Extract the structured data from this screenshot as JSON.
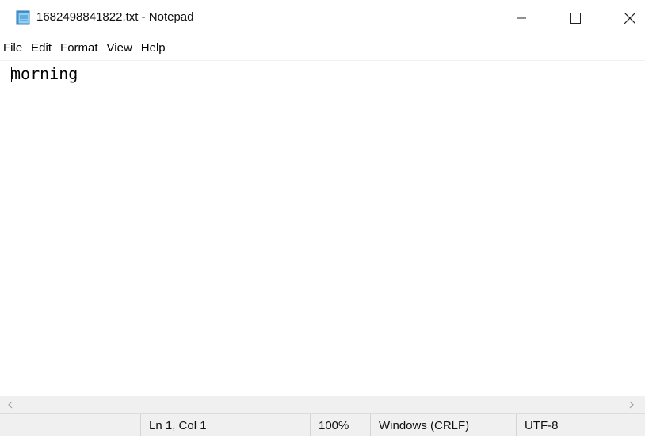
{
  "window": {
    "title": "1682498841822.txt - Notepad",
    "app_icon": "notepad-icon",
    "controls": [
      "minimize-icon",
      "maximize-icon",
      "close-icon"
    ]
  },
  "menu": {
    "items": [
      {
        "label": "File"
      },
      {
        "label": "Edit"
      },
      {
        "label": "Format"
      },
      {
        "label": "View"
      },
      {
        "label": "Help"
      }
    ]
  },
  "editor": {
    "content": "morning"
  },
  "status": {
    "position": "Ln 1, Col 1",
    "zoom": "100%",
    "line_ending": "Windows (CRLF)",
    "encoding": "UTF-8"
  }
}
